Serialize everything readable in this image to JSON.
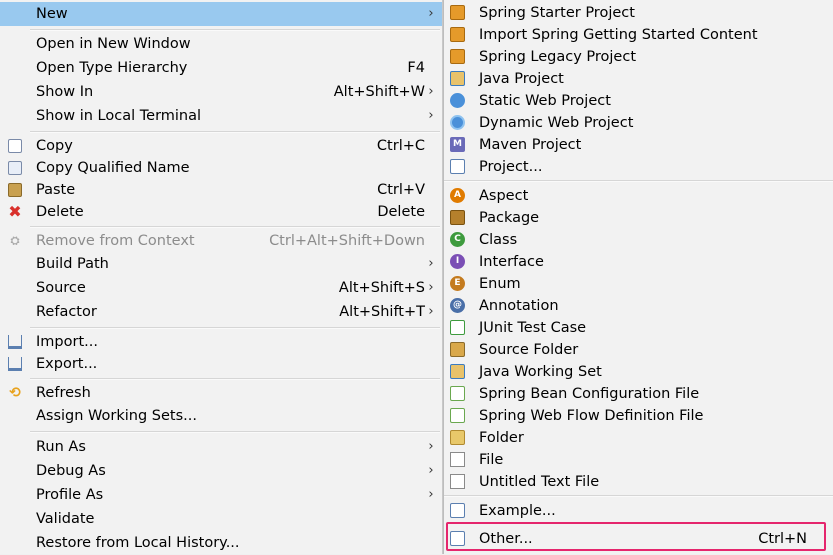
{
  "context_menu": {
    "items": [
      {
        "label": "New",
        "arrow": "›",
        "accel": ""
      },
      {
        "label": "Open in New Window",
        "accel": ""
      },
      {
        "label": "Open Type Hierarchy",
        "accel": "F4"
      },
      {
        "label": "Show In",
        "accel": "Alt+Shift+W",
        "arrow": "›"
      },
      {
        "label": "Show in Local Terminal",
        "accel": "",
        "arrow": "›"
      },
      {
        "label": "Copy",
        "accel": "Ctrl+C"
      },
      {
        "label": "Copy Qualified Name",
        "accel": ""
      },
      {
        "label": "Paste",
        "accel": "Ctrl+V"
      },
      {
        "label": "Delete",
        "accel": "Delete"
      },
      {
        "label": "Remove from Context",
        "accel": "Ctrl+Alt+Shift+Down"
      },
      {
        "label": "Build Path",
        "accel": "",
        "arrow": "›"
      },
      {
        "label": "Source",
        "accel": "Alt+Shift+S",
        "arrow": "›"
      },
      {
        "label": "Refactor",
        "accel": "Alt+Shift+T",
        "arrow": "›"
      },
      {
        "label": "Import...",
        "accel": ""
      },
      {
        "label": "Export...",
        "accel": ""
      },
      {
        "label": "Refresh",
        "accel": ""
      },
      {
        "label": "Assign Working Sets...",
        "accel": ""
      },
      {
        "label": "Run As",
        "accel": "",
        "arrow": "›"
      },
      {
        "label": "Debug As",
        "accel": "",
        "arrow": "›"
      },
      {
        "label": "Profile As",
        "accel": "",
        "arrow": "›"
      },
      {
        "label": "Validate",
        "accel": ""
      },
      {
        "label": "Restore from Local History...",
        "accel": ""
      }
    ]
  },
  "new_submenu": {
    "items": [
      {
        "label": "Spring Starter Project"
      },
      {
        "label": "Import Spring Getting Started Content"
      },
      {
        "label": "Spring Legacy Project"
      },
      {
        "label": "Java Project"
      },
      {
        "label": "Static Web Project"
      },
      {
        "label": "Dynamic Web Project"
      },
      {
        "label": "Maven Project"
      },
      {
        "label": "Project..."
      },
      {
        "label": "Aspect"
      },
      {
        "label": "Package"
      },
      {
        "label": "Class"
      },
      {
        "label": "Interface"
      },
      {
        "label": "Enum"
      },
      {
        "label": "Annotation"
      },
      {
        "label": "JUnit Test Case"
      },
      {
        "label": "Source Folder"
      },
      {
        "label": "Java Working Set"
      },
      {
        "label": "Spring Bean Configuration File"
      },
      {
        "label": "Spring Web Flow Definition File"
      },
      {
        "label": "Folder"
      },
      {
        "label": "File"
      },
      {
        "label": "Untitled Text File"
      },
      {
        "label": "Example..."
      },
      {
        "label": "Other...",
        "accel": "Ctrl+N"
      }
    ]
  },
  "icons": {
    "spring": "#e59a2a",
    "java": "#3b7bbf",
    "web": "#4a90d9",
    "maven": "#6a6ab8",
    "aspect": "#e07b00",
    "package": "#b5802c",
    "class": "#3e9b3e",
    "interface": "#7b4fb5",
    "enum": "#c47b1f",
    "annotation": "#4a6fa8",
    "delete": "#d9302b",
    "refresh": "#e8a21d",
    "highlight": "#99c9ef",
    "focus_ring": "#e5266d"
  }
}
